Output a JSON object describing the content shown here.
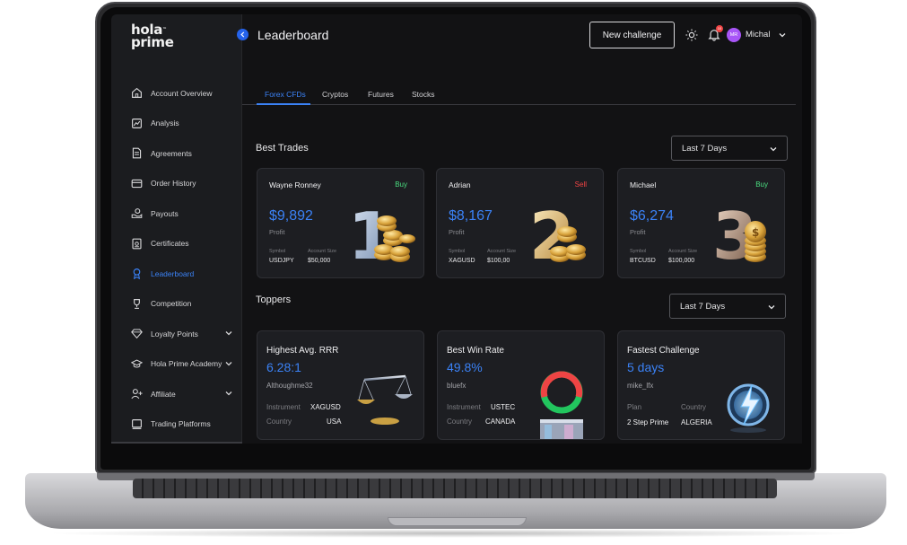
{
  "brand": {
    "logo_line1": "hola",
    "logo_line2": "prime",
    "logo_tm": "™"
  },
  "sidebar": {
    "items": [
      {
        "label": "Account Overview",
        "icon": "home-icon"
      },
      {
        "label": "Analysis",
        "icon": "chart-icon"
      },
      {
        "label": "Agreements",
        "icon": "document-icon"
      },
      {
        "label": "Order History",
        "icon": "card-icon"
      },
      {
        "label": "Payouts",
        "icon": "hand-coin-icon"
      },
      {
        "label": "Certificates",
        "icon": "certificate-icon"
      },
      {
        "label": "Leaderboard",
        "icon": "medal-icon",
        "active": true
      },
      {
        "label": "Competition",
        "icon": "trophy-icon"
      },
      {
        "label": "Loyalty Points",
        "icon": "diamond-icon",
        "expandable": true
      },
      {
        "label": "Hola Prime Academy",
        "icon": "graduation-cap-icon",
        "expandable": true
      },
      {
        "label": "Affiliate",
        "icon": "user-add-icon",
        "expandable": true
      },
      {
        "label": "Trading Platforms",
        "icon": "monitor-icon"
      }
    ]
  },
  "header": {
    "title": "Leaderboard",
    "new_challenge_label": "New challenge",
    "notification_count": "10",
    "user_initials": "MR",
    "user_name": "Michal"
  },
  "tabs": [
    {
      "label": "Forex CFDs",
      "active": true
    },
    {
      "label": "Cryptos"
    },
    {
      "label": "Futures"
    },
    {
      "label": "Stocks"
    }
  ],
  "best_trades": {
    "title": "Best Trades",
    "period": "Last 7 Days",
    "cards": [
      {
        "name": "Wayne Ronney",
        "side": "Buy",
        "profit": "$9,892",
        "profit_label": "Profit",
        "symbol_label": "Symbol",
        "symbol": "USDJPY",
        "account_size_label": "Account Size",
        "account_size": "$50,000",
        "rank": "1"
      },
      {
        "name": "Adrian",
        "side": "Sell",
        "profit": "$8,167",
        "profit_label": "Profit",
        "symbol_label": "Symbol",
        "symbol": "XAGUSD",
        "account_size_label": "Account Size",
        "account_size": "$100,00",
        "rank": "2"
      },
      {
        "name": "Michael",
        "side": "Buy",
        "profit": "$6,274",
        "profit_label": "Profit",
        "symbol_label": "Symbol",
        "symbol": "BTCUSD",
        "account_size_label": "Account Size",
        "account_size": "$100,000",
        "rank": "3"
      }
    ]
  },
  "toppers": {
    "title": "Toppers",
    "period": "Last 7 Days",
    "cards": [
      {
        "title": "Highest Avg. RRR",
        "value": "6.28:1",
        "user": "Althoughme32",
        "k1": "Instrument",
        "v1": "XAGUSD",
        "k2": "Country",
        "v2": "USA",
        "art": "scale-icon"
      },
      {
        "title": "Best Win Rate",
        "value": "49.8%",
        "user": "bluefx",
        "k1": "Instrument",
        "v1": "USTEC",
        "k2": "Country",
        "v2": "CANADA",
        "art": "ring-chart-icon"
      },
      {
        "title": "Fastest Challenge",
        "value": "5 days",
        "user": "mike_lfx",
        "k1": "Plan",
        "v1": "2 Step Prime",
        "k2": "Country",
        "v2": "ALGERIA",
        "art": "lightning-clock-icon"
      }
    ]
  },
  "colors": {
    "accent": "#3b82f6",
    "buy": "#4ade80",
    "sell": "#ef4444",
    "avatar": "#a855f7"
  }
}
